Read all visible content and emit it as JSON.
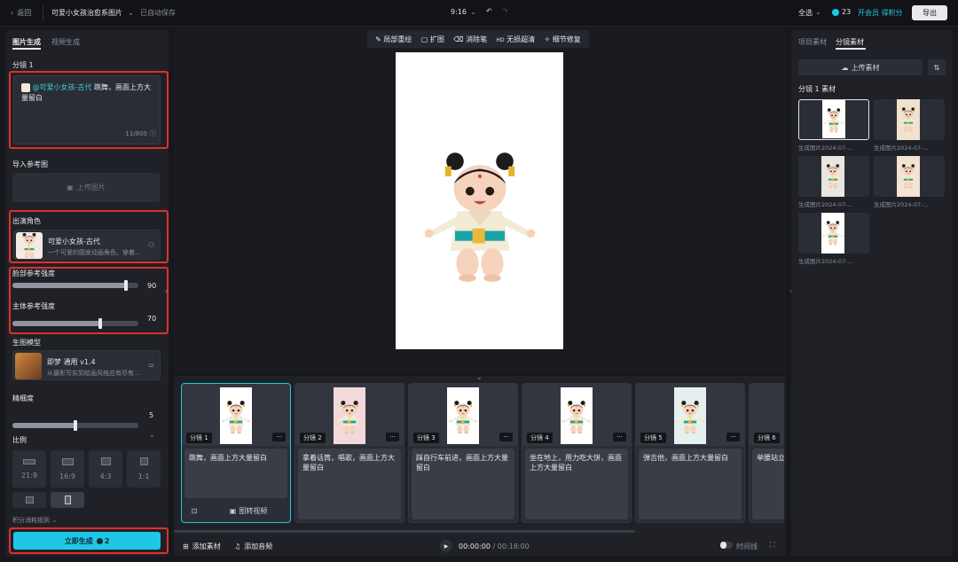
{
  "topbar": {
    "back_label": "返回",
    "project_title": "可爱小女孩治愈系图片",
    "autosave": "已自动保存",
    "aspect": "9:16",
    "zoom_label": "全选",
    "credits": "23",
    "member_label": "开会员 得积分",
    "export_label": "导出"
  },
  "left": {
    "tabs": [
      "图片生成",
      "视频生成"
    ],
    "shot_title": "分镜 1",
    "prompt_mention": "@可爱小女孩-古代",
    "prompt_text": "跳舞，画面上方大量留白",
    "prompt_count": "11/800",
    "ref_title": "导入参考图",
    "upload_label": "上传图片",
    "role_title": "出演角色",
    "role_name": "可爱小女孩-古代",
    "role_desc": "一个可爱的圆发动画角色，穿着...",
    "face_label": "脸部参考强度",
    "face_value": "90",
    "face_level": 90,
    "body_label": "主体参考强度",
    "body_value": "70",
    "body_level": 70,
    "model_title": "生图模型",
    "model_name": "即梦 通用 v1.4",
    "model_desc": "从摄影写实到绘画风格应有尽有...",
    "precision_title": "精细度",
    "precision_value": "5",
    "precision_level": 50,
    "ratio_title": "比例",
    "ratios": [
      "21:9",
      "16:9",
      "4:3",
      "1:1",
      "",
      ""
    ],
    "more_label": "积分消耗规则",
    "generate_label": "立即生成",
    "generate_cost": "2"
  },
  "canvas": {
    "tools": [
      "局部重绘",
      "扩图",
      "消除笔",
      "无损超清",
      "细节修复"
    ]
  },
  "timeline": {
    "shots": [
      {
        "label": "分镜 1",
        "text": "跳舞，画面上方大量留白"
      },
      {
        "label": "分镜 2",
        "text": "拿着话筒，唱歌，画面上方大量留白"
      },
      {
        "label": "分镜 3",
        "text": "踩自行车前进，画面上方大量留白"
      },
      {
        "label": "分镜 4",
        "text": "坐在地上，用力吃大饼，画面上方大量留白"
      },
      {
        "label": "分镜 5",
        "text": "弹吉他，画面上方大量留白"
      },
      {
        "label": "分镜 6",
        "text": "举腰站立，画面上方大量留白"
      }
    ],
    "to_video": "图转视频",
    "add_material": "添加素材",
    "add_audio": "添加音频",
    "time_current": "00:00:00",
    "time_total": "/ 00:18:00",
    "timeline_label": "时间线"
  },
  "right": {
    "tabs": [
      "项目素材",
      "分镜素材"
    ],
    "upload_label": "上传素材",
    "section_title": "分镜 1 素材",
    "items": [
      "生成图片2024-07-...",
      "生成图片2024-07-...",
      "生成图片2024-07-...",
      "生成图片2024-07-...",
      "生成图片2024-07-..."
    ]
  },
  "colors": {
    "accent": "#1fc7e6",
    "red": "#e0302a",
    "teal": "#1ba8b0",
    "gold": "#e8b93a"
  }
}
